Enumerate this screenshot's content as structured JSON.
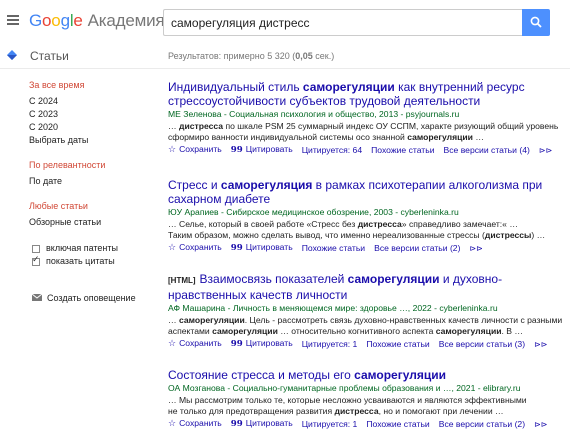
{
  "header": {
    "logo_google": [
      "G",
      "o",
      "o",
      "g",
      "l",
      "e"
    ],
    "logo_suffix": "Академия",
    "search_value": "саморегуляция дистресс"
  },
  "subbar": {
    "articles_label": "Статьи",
    "results_prefix": "Результатов: примерно 5 320 (",
    "results_time": "0,05",
    "results_suffix": " сек.)"
  },
  "sidebar": {
    "time_head": "За все время",
    "time_items": [
      "С 2024",
      "С 2023",
      "С 2020",
      "Выбрать даты"
    ],
    "sort_head": "По релевантности",
    "sort_items": [
      "По дате"
    ],
    "type_head": "Любые статьи",
    "type_items": [
      "Обзорные статьи"
    ],
    "checks": [
      {
        "label": "включая патенты",
        "checked": false
      },
      {
        "label": "показать цитаты",
        "checked": true
      }
    ],
    "alert": "Создать оповещение"
  },
  "results": [
    {
      "tag": "",
      "title_parts": [
        [
          "Индивидуальный стиль ",
          false
        ],
        [
          "саморегуляции",
          true
        ],
        [
          " как внутренний ресурс стрессоустойчивости субъектов трудовой деятельности",
          false
        ]
      ],
      "meta": "МЕ Зеленова - Социальная психология и общество, 2013 - psyjournals.ru",
      "snippet_parts": [
        [
          "… ",
          false
        ],
        [
          "дистресса",
          true
        ],
        [
          " по шкале PSM 25 суммарный индекс ОУ ССПМ, характе ризующий общий уровень сформиро ванности индивидуальной системы осо знанной ",
          false
        ],
        [
          "саморегуляции",
          true
        ],
        [
          " …",
          false
        ]
      ],
      "actions": {
        "save": "Сохранить",
        "cite": "Цитировать",
        "cited": "Цитируется: 64",
        "related": "Похожие статьи",
        "versions": "Все версии статьи (4)"
      }
    },
    {
      "tag": "",
      "title_parts": [
        [
          "Стресс и ",
          false
        ],
        [
          "саморегуляция",
          true
        ],
        [
          " в рамках психотерапии алкоголизма при сахарном диабете",
          false
        ]
      ],
      "meta": "ЮУ Арапиев - Сибирское медицинское обозрение, 2003 - cyberleninka.ru",
      "snippet_parts": [
        [
          "… Селье, который в своей работе «Стресс без ",
          false
        ],
        [
          "дистресса",
          true
        ],
        [
          "» справедливо замечает:« …",
          false
        ],
        [
          "\nТаким образом, можно сделать вывод, что именно нереализованные стрессы (",
          false
        ],
        [
          "дистрессы",
          true
        ],
        [
          ") …",
          false
        ]
      ],
      "actions": {
        "save": "Сохранить",
        "cite": "Цитировать",
        "cited": "",
        "related": "Похожие статьи",
        "versions": "Все версии статьи (2)"
      }
    },
    {
      "tag": "[HTML]",
      "title_parts": [
        [
          "Взаимосвязь показателей ",
          false
        ],
        [
          "саморегуляции",
          true
        ],
        [
          " и духовно-нравственных качеств личности",
          false
        ]
      ],
      "meta": "АФ Машарина - Личность в меняющемся мире: здоровье …, 2022 - cyberleninka.ru",
      "snippet_parts": [
        [
          "… ",
          false
        ],
        [
          "саморегуляции",
          true
        ],
        [
          ". Цель - рассмотреть связь духовно-нравственных качеств личности с разными аспектами ",
          false
        ],
        [
          "саморегуляции",
          true
        ],
        [
          " … относительно когнитивного аспекта ",
          false
        ],
        [
          "саморегуляции",
          true
        ],
        [
          ". В …",
          false
        ]
      ],
      "actions": {
        "save": "Сохранить",
        "cite": "Цитировать",
        "cited": "Цитируется: 1",
        "related": "Похожие статьи",
        "versions": "Все версии статьи (3)"
      }
    },
    {
      "tag": "",
      "title_parts": [
        [
          "Состояние стресса и методы его ",
          false
        ],
        [
          "саморегуляции",
          true
        ]
      ],
      "meta": "ОА Мозганова - Социально-гуманитарные проблемы образования и …, 2021 - elibrary.ru",
      "snippet_parts": [
        [
          "… Мы рассмотрим только те, которые несложно усваиваются и являются эффективными\nне только для предотвращения развития ",
          false
        ],
        [
          "дистресса",
          true
        ],
        [
          ", но и помогают при лечении …",
          false
        ]
      ],
      "actions": {
        "save": "Сохранить",
        "cite": "Цитировать",
        "cited": "Цитируется: 1",
        "related": "Похожие статьи",
        "versions": "Все версии статьи (2)"
      }
    }
  ],
  "colors": {
    "accent": "#4d90fe",
    "link": "#1a0dab",
    "meta": "#006621",
    "filter_active": "#d14836"
  }
}
